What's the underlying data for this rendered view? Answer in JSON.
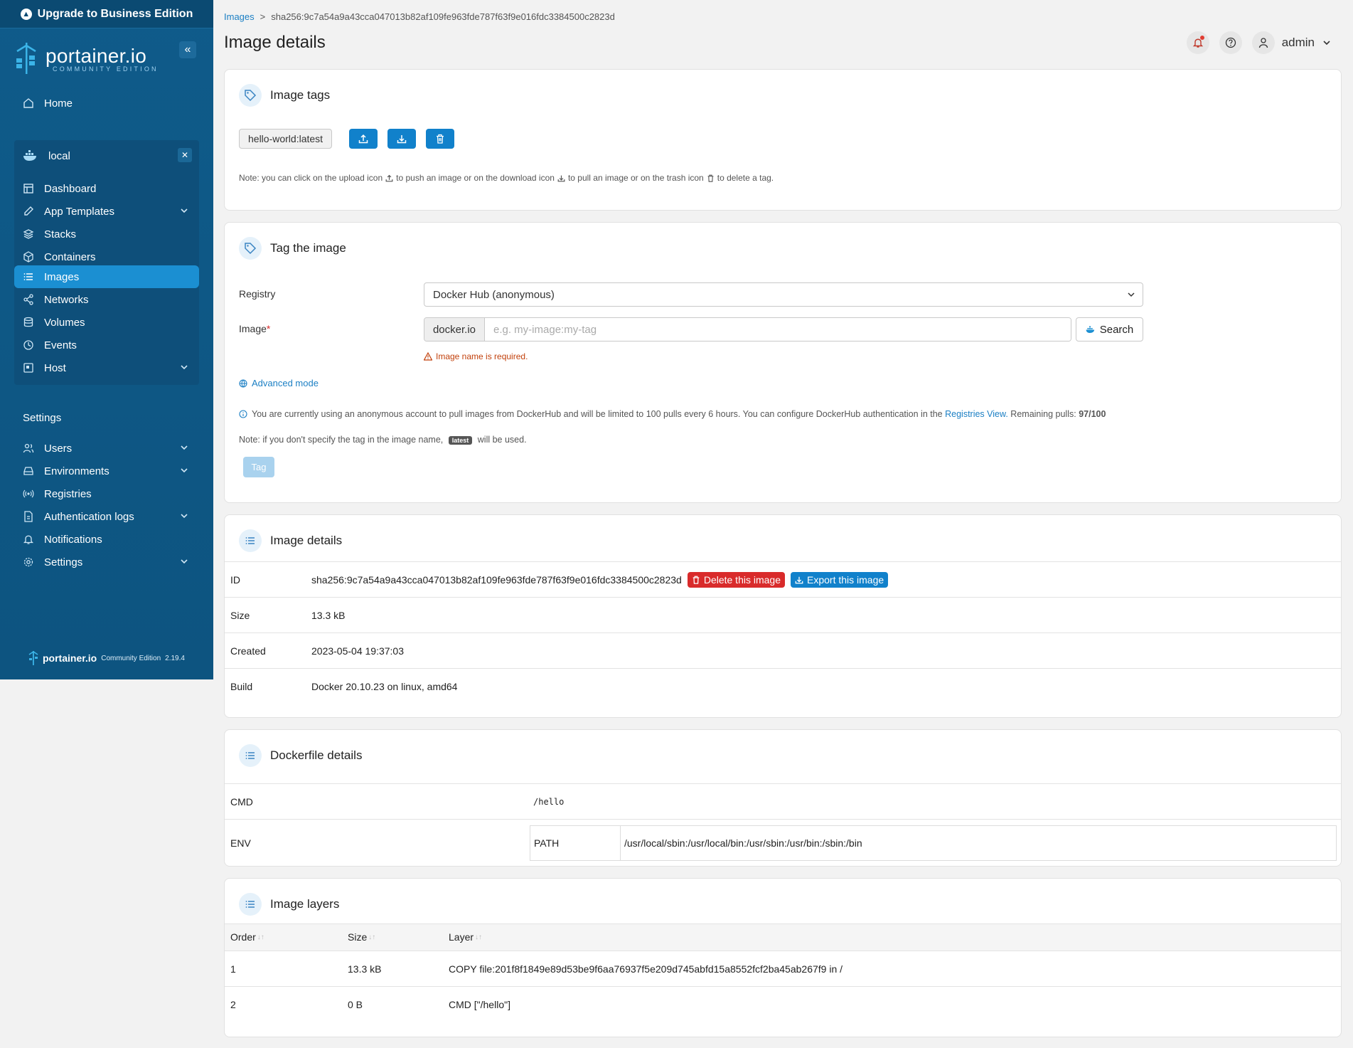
{
  "sidebar": {
    "upgrade_label": "Upgrade to Business Edition",
    "brand_name": "portainer.io",
    "brand_edition": "COMMUNITY EDITION",
    "home_label": "Home",
    "env_name": "local",
    "env_items": [
      {
        "label": "Dashboard",
        "icon": "dashboard-icon"
      },
      {
        "label": "App Templates",
        "icon": "edit-icon"
      },
      {
        "label": "Stacks",
        "icon": "layers-icon"
      },
      {
        "label": "Containers",
        "icon": "box-icon"
      },
      {
        "label": "Images",
        "icon": "list-icon"
      },
      {
        "label": "Networks",
        "icon": "share-icon"
      },
      {
        "label": "Volumes",
        "icon": "database-icon"
      },
      {
        "label": "Events",
        "icon": "clock-icon"
      },
      {
        "label": "Host",
        "icon": "server-icon"
      }
    ],
    "settings_heading": "Settings",
    "settings_items": [
      {
        "label": "Users",
        "icon": "users-icon"
      },
      {
        "label": "Environments",
        "icon": "hard-drive-icon"
      },
      {
        "label": "Registries",
        "icon": "radio-icon"
      },
      {
        "label": "Authentication logs",
        "icon": "file-icon"
      },
      {
        "label": "Notifications",
        "icon": "bell-icon"
      },
      {
        "label": "Settings",
        "icon": "gear-icon"
      }
    ],
    "footer_brand": "portainer.io",
    "footer_edition": "Community Edition",
    "footer_version": "2.19.4"
  },
  "header": {
    "breadcrumb_images": "Images",
    "breadcrumb_sep": ">",
    "breadcrumb_current": "sha256:9c7a54a9a43cca047013b82af109fe963fde787f63f9e016fdc3384500c2823d",
    "title": "Image details",
    "user": "admin"
  },
  "image_tags": {
    "title": "Image tags",
    "tag": "hello-world:latest",
    "note_parts": [
      "Note: you can click on the upload icon",
      "to push an image or on the download icon",
      "to pull an image or on the trash icon",
      "to delete a tag."
    ]
  },
  "tag_image": {
    "title": "Tag the image",
    "registry_label": "Registry",
    "registry_value": "Docker Hub (anonymous)",
    "image_label": "Image",
    "required_mark": "*",
    "image_prefix": "docker.io",
    "image_placeholder": "e.g. my-image:my-tag",
    "search_label": "Search",
    "error": "Image name is required.",
    "advanced_mode": "Advanced mode",
    "info_text": "You are currently using an anonymous account to pull images from DockerHub and will be limited to 100 pulls every 6 hours. You can configure DockerHub authentication in the",
    "info_link": "Registries View.",
    "info_remaining_label": "Remaining pulls:",
    "info_remaining_value": "97/100",
    "note_prefix": "Note: if you don't specify the tag in the image name,",
    "note_badge": "latest",
    "note_suffix": "will be used.",
    "tag_button": "Tag"
  },
  "details": {
    "title": "Image details",
    "rows": [
      {
        "key": "ID",
        "value": "sha256:9c7a54a9a43cca047013b82af109fe963fde787f63f9e016fdc3384500c2823d"
      },
      {
        "key": "Size",
        "value": "13.3 kB"
      },
      {
        "key": "Created",
        "value": "2023-05-04 19:37:03"
      },
      {
        "key": "Build",
        "value": "Docker 20.10.23 on linux, amd64"
      }
    ],
    "delete_label": "Delete this image",
    "export_label": "Export this image"
  },
  "dockerfile": {
    "title": "Dockerfile details",
    "cmd_key": "CMD",
    "cmd_value": "/hello",
    "env_key": "ENV",
    "env_name": "PATH",
    "env_value": "/usr/local/sbin:/usr/local/bin:/usr/sbin:/usr/bin:/sbin:/bin"
  },
  "layers": {
    "title": "Image layers",
    "columns": [
      "Order",
      "Size",
      "Layer"
    ],
    "rows": [
      {
        "order": "1",
        "size": "13.3 kB",
        "layer": "COPY file:201f8f1849e89d53be9f6aa76937f5e209d745abfd15a8552fcf2ba45ab267f9 in /"
      },
      {
        "order": "2",
        "size": "0 B",
        "layer": "CMD [\"/hello\"]"
      }
    ]
  },
  "colors": {
    "sidebar_bg": "#0f5b8a",
    "active_item": "#1b8fd2",
    "primary": "#1181cb",
    "danger": "#d92b2b",
    "error_text": "#c2410c"
  }
}
